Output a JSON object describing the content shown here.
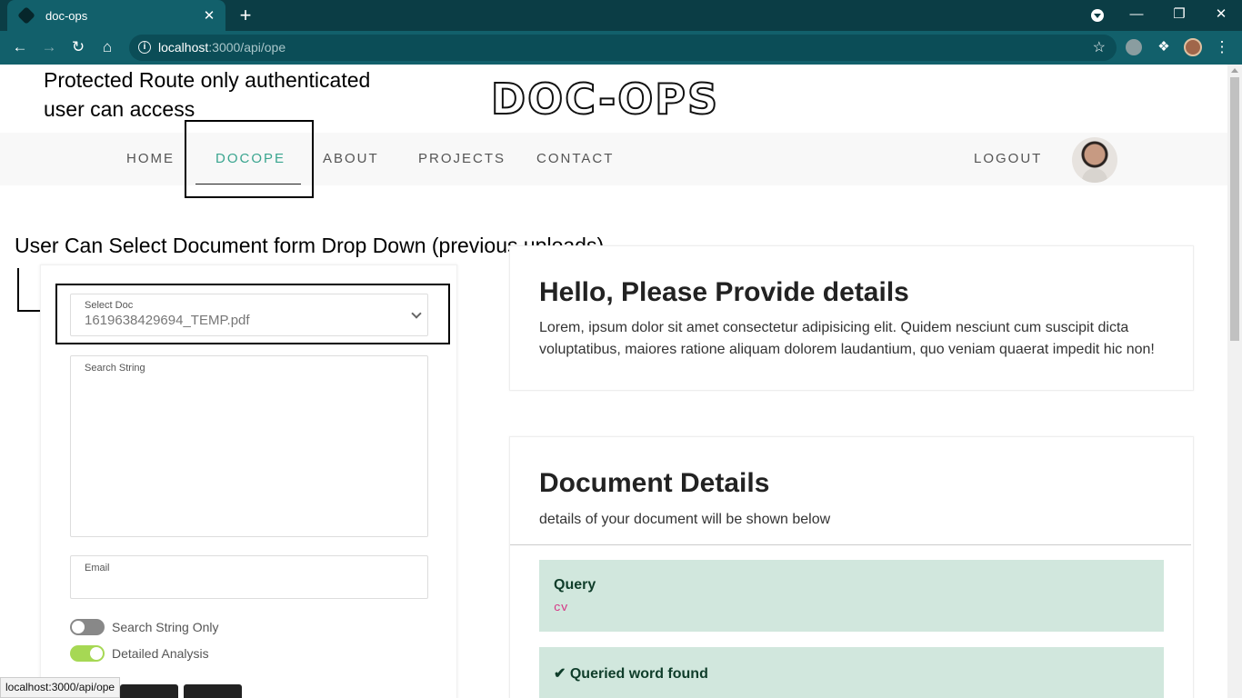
{
  "browser": {
    "tab_title": "doc-ops",
    "tab_close": "✕",
    "new_tab": "+",
    "url_host": "localhost",
    "url_path": ":3000/api/ope",
    "minimize": "—",
    "restore": "❐",
    "close": "✕"
  },
  "annotations": {
    "protected_route": "Protected Route only authenticated user can access",
    "select_doc_note": "User Can Select Document form Drop Down (previous uploads)"
  },
  "site": {
    "logo": "DOC-OPS",
    "nav": [
      "HOME",
      "DOCOPE",
      "ABOUT",
      "PROJECTS",
      "CONTACT"
    ],
    "active_nav": "DOCOPE",
    "logout": "LOGOUT"
  },
  "form": {
    "select_label": "Select Doc",
    "select_value": "1619638429694_TEMP.pdf",
    "search_label": "Search String",
    "email_label": "Email",
    "toggles": [
      {
        "label": "Search String Only",
        "on": false
      },
      {
        "label": "Detailed Analysis",
        "on": true
      }
    ]
  },
  "hello_card": {
    "title": "Hello, Please Provide details",
    "text": "Lorem, ipsum dolor sit amet consectetur adipisicing elit. Quidem nesciunt cum suscipit dicta voluptatibus, maiores ratione aliquam dolorem laudantium, quo veniam quaerat impedit hic non!"
  },
  "details_card": {
    "title": "Document Details",
    "subtitle": "details of your document will be shown below",
    "query_label": "Query",
    "query_value": "cv",
    "found_label": "Queried word found"
  },
  "colors": {
    "accent": "#3aa58f",
    "alert_bg": "#d1e7dd",
    "chrome": "#12606b",
    "toggle_on": "#a6d854",
    "toggle_off": "#888888"
  },
  "status_url": "localhost:3000/api/ope"
}
